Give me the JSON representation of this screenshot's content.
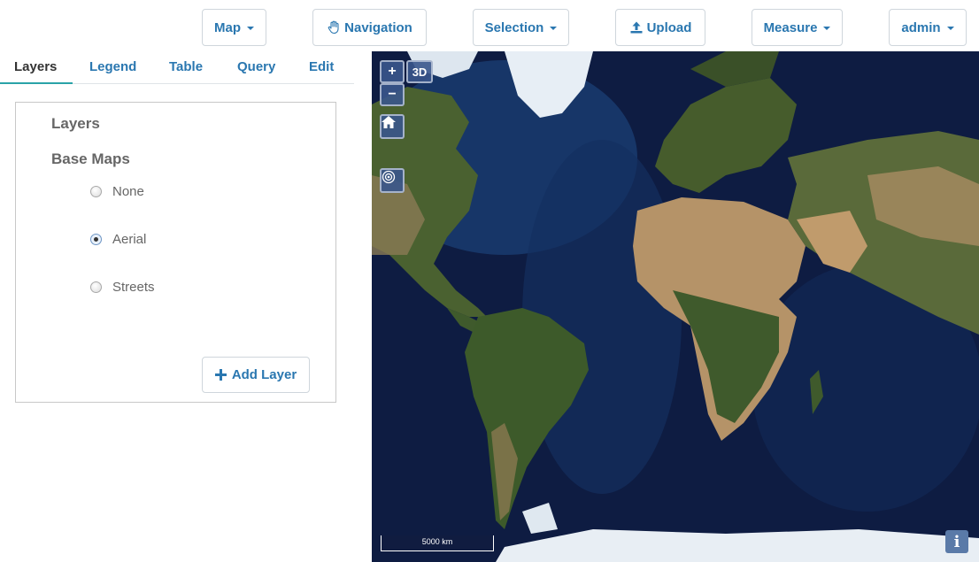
{
  "toolbar": {
    "map_label": "Map",
    "navigation_label": "Navigation",
    "selection_label": "Selection",
    "upload_label": "Upload",
    "measure_label": "Measure",
    "user_label": "admin"
  },
  "tabs": {
    "layers": "Layers",
    "legend": "Legend",
    "table": "Table",
    "query": "Query",
    "edit": "Edit"
  },
  "layers_panel": {
    "layers_title": "Layers",
    "base_maps_title": "Base Maps",
    "base_maps": [
      {
        "label": "None",
        "selected": false
      },
      {
        "label": "Aerial",
        "selected": true
      },
      {
        "label": "Streets",
        "selected": false
      }
    ],
    "add_layer_label": "Add Layer"
  },
  "map": {
    "zoom_in": "+",
    "zoom_out": "−",
    "view_3d": "3D",
    "scale_label": "5000 km",
    "info": "i",
    "icons": [
      "home-icon",
      "locate-icon",
      "info-icon"
    ],
    "colors": {
      "ocean_deep": "#0d1a3c",
      "ocean_shallow": "#1f4f86",
      "land": "#3f5a2c",
      "desert": "#b6946a",
      "ice": "#e8eef4"
    }
  },
  "colors": {
    "accent": "#2a77b0",
    "tab_underline": "#2aa3a8"
  }
}
